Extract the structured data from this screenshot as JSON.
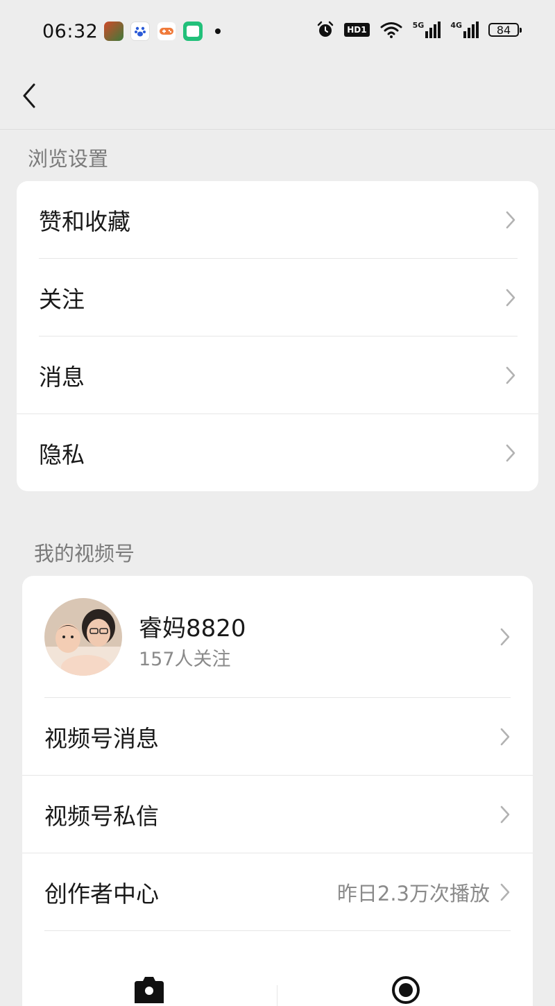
{
  "status_bar": {
    "time": "06:32",
    "hd_label": "HD1",
    "net1": "5G",
    "net2": "4G",
    "battery": "84",
    "icons": [
      "game-app-icon",
      "baidu-app-icon",
      "game-controller-app-icon",
      "qu-app-icon",
      "alarm-icon",
      "wifi-icon",
      "signal-icon"
    ]
  },
  "browse_settings": {
    "title": "浏览设置",
    "items": [
      {
        "label": "赞和收藏"
      },
      {
        "label": "关注"
      },
      {
        "label": "消息"
      },
      {
        "label": "隐私"
      }
    ]
  },
  "channels": {
    "title": "我的视频号",
    "profile": {
      "name": "睿妈8820",
      "followers": "157人关注"
    },
    "items": [
      {
        "label": "视频号消息",
        "value": ""
      },
      {
        "label": "视频号私信",
        "value": ""
      },
      {
        "label": "创作者中心",
        "value": "昨日2.3万次播放"
      }
    ],
    "actions": [
      "camera-icon",
      "live-record-icon"
    ]
  },
  "colors": {
    "background": "#ededed",
    "card": "#ffffff",
    "text": "#191919",
    "secondary": "#8a8a8a"
  }
}
